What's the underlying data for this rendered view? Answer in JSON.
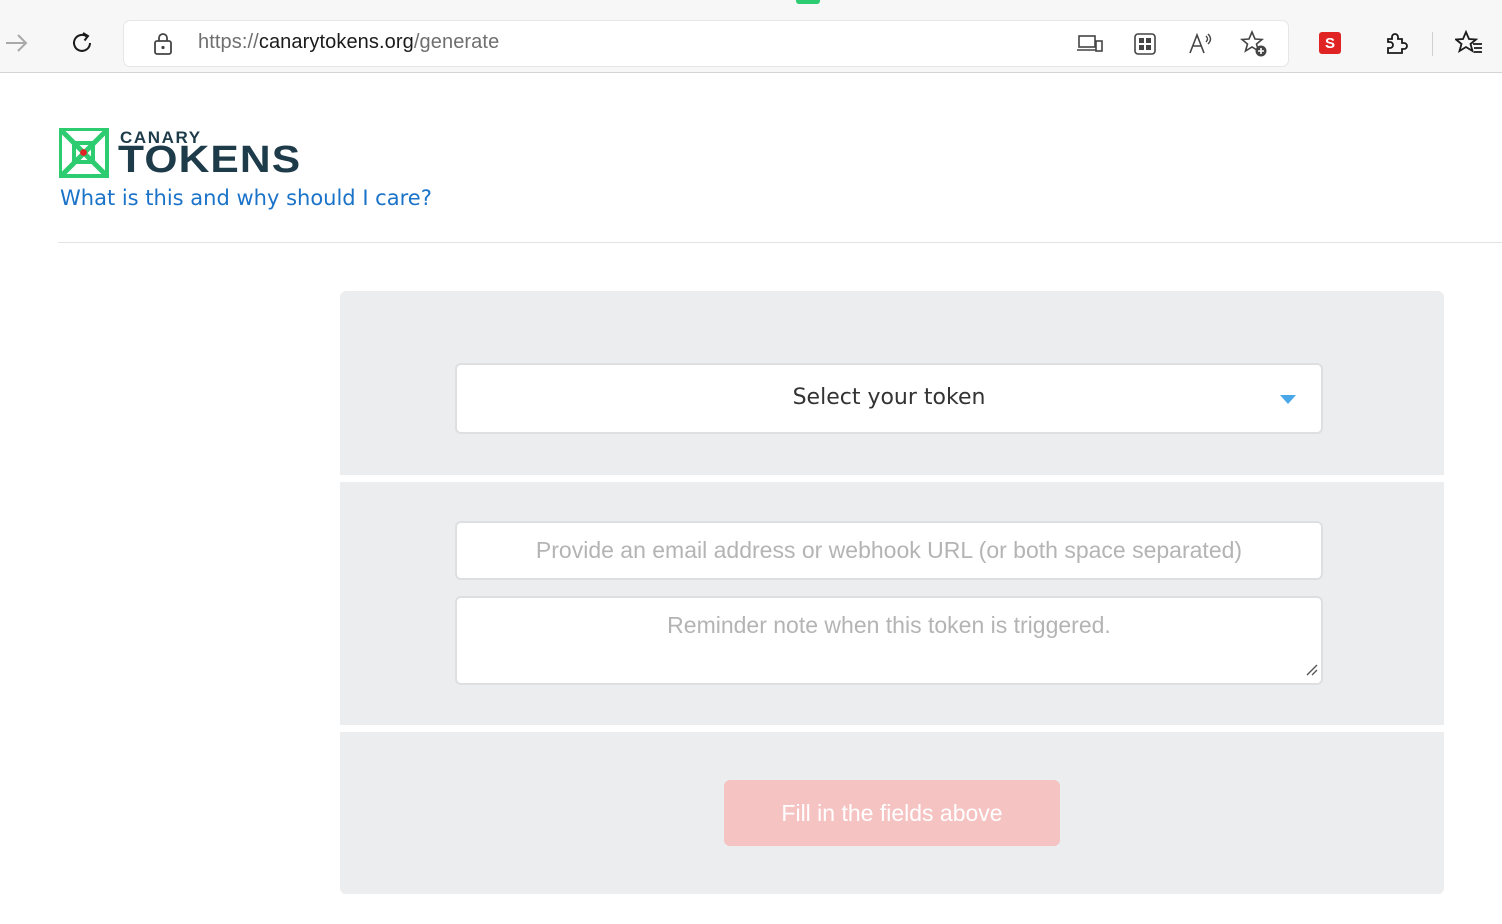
{
  "browser": {
    "url_scheme": "https://",
    "url_host": "canarytokens.org",
    "url_path": "/generate",
    "extension_badge": "S"
  },
  "icons": {
    "forward": "forward-arrow-icon",
    "refresh": "refresh-icon",
    "lock": "lock-icon",
    "devices": "app-available-icon",
    "apps": "apps-grid-icon",
    "read_aloud": "read-aloud-icon",
    "favorite_add": "add-favorite-icon",
    "extension": "extensions-puzzle-icon",
    "favorites": "favorites-icon",
    "dropdown": "chevron-down-icon",
    "resize": "resize-handle-icon"
  },
  "header": {
    "logo_small": "CANARY",
    "logo_large": "TOKENS",
    "about_link": "What is this and why should I care?"
  },
  "form": {
    "token_select": "Select your token",
    "email_placeholder": "Provide an email address or webhook URL (or both space separated)",
    "memo_placeholder": "Reminder note when this token is triggered.",
    "submit_label": "Fill in the fields above"
  },
  "colors": {
    "brand_green": "#2ecc71",
    "brand_dark": "#1e3b4a",
    "link_blue": "#1a73c9",
    "caret_blue": "#4aa8e8",
    "submit_disabled": "#f6c3c3",
    "panel_bg": "#ecedef"
  }
}
